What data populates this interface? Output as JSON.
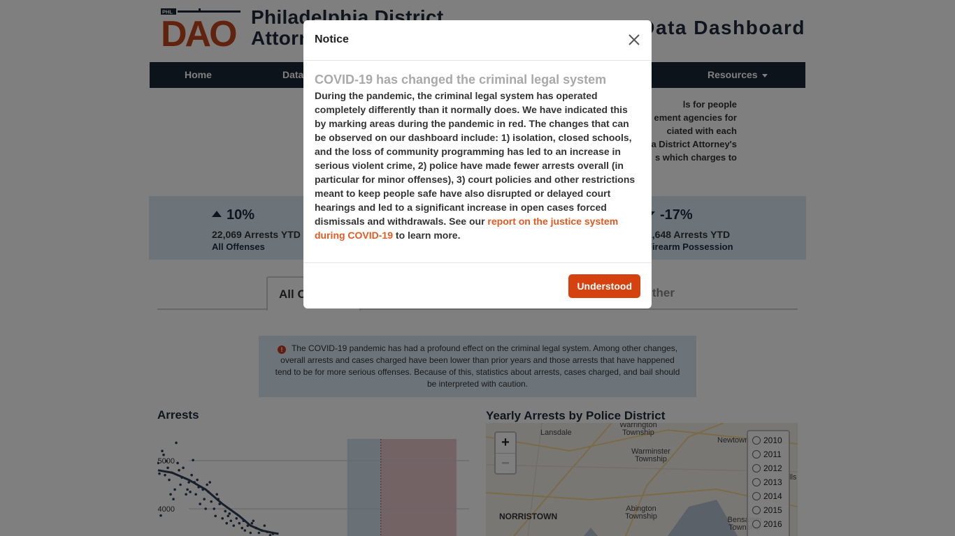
{
  "header": {
    "logo_badge": "PHL",
    "logo_text": "DAO",
    "site_title_line1": "Philadelphia District",
    "site_title_line2": "Attorney's Office",
    "dashboard_title": "Public Data Dashboard"
  },
  "nav": {
    "items": [
      "Home",
      "Data",
      "Resources"
    ]
  },
  "intro": {
    "lines": [
      "ls for people",
      "ement agencies for",
      "ciated with each",
      "a District Attorney's",
      "s which charges to"
    ]
  },
  "stats": [
    {
      "direction": "up",
      "percent": "10%",
      "count": "22,069 Arrests YTD",
      "category": "All Offenses"
    },
    {
      "direction": "down",
      "percent": "-17%",
      "count": "1,648 Arrests YTD",
      "category": "Firearm Possession"
    }
  ],
  "tabs": {
    "active": "All Offenses",
    "other": "Other"
  },
  "covid_note": {
    "icon": "exclamation-circle-icon",
    "text": "The COVID-19 pandemic has had a profound effect on the criminal legal system. Among other changes, overall arrests and cases charged have been lower than prior years and those arrests that have happened tend to be for more serious offenses. Because of this, statistics about arrests, cases charged, and bail should be interpreted with caution."
  },
  "arrests_chart": {
    "title": "Arrests"
  },
  "chart_data": {
    "type": "scatter",
    "title": "Arrests",
    "xlabel": "",
    "ylabel": "",
    "y_ticks": [
      4000,
      5000
    ],
    "ylim": [
      3450,
      5450
    ],
    "x_range": [
      0,
      1
    ],
    "points": [
      [
        0.01,
        4950
      ],
      [
        0.015,
        4730
      ],
      [
        0.02,
        3860
      ],
      [
        0.025,
        5200
      ],
      [
        0.03,
        5120
      ],
      [
        0.035,
        4700
      ],
      [
        0.04,
        4990
      ],
      [
        0.045,
        4850
      ],
      [
        0.05,
        4600
      ],
      [
        0.055,
        4300
      ],
      [
        0.06,
        4750
      ],
      [
        0.065,
        4200
      ],
      [
        0.07,
        4400
      ],
      [
        0.075,
        5370
      ],
      [
        0.08,
        4950
      ],
      [
        0.085,
        4800
      ],
      [
        0.09,
        4500
      ],
      [
        0.095,
        4650
      ],
      [
        0.1,
        4850
      ],
      [
        0.11,
        4300
      ],
      [
        0.115,
        4400
      ],
      [
        0.12,
        4550
      ],
      [
        0.125,
        4350
      ],
      [
        0.13,
        4700
      ],
      [
        0.135,
        5010
      ],
      [
        0.14,
        4550
      ],
      [
        0.145,
        4300
      ],
      [
        0.15,
        4600
      ],
      [
        0.155,
        4450
      ],
      [
        0.16,
        4100
      ],
      [
        0.17,
        4400
      ],
      [
        0.175,
        4200
      ],
      [
        0.18,
        4000
      ],
      [
        0.185,
        4500
      ],
      [
        0.19,
        4350
      ],
      [
        0.195,
        4550
      ],
      [
        0.2,
        4150
      ],
      [
        0.21,
        4000
      ],
      [
        0.215,
        3850
      ],
      [
        0.22,
        4300
      ],
      [
        0.225,
        4200
      ],
      [
        0.23,
        4100
      ],
      [
        0.24,
        3800
      ],
      [
        0.25,
        3950
      ],
      [
        0.255,
        3700
      ],
      [
        0.26,
        3850
      ],
      [
        0.265,
        3900
      ],
      [
        0.27,
        3750
      ],
      [
        0.28,
        3650
      ],
      [
        0.29,
        3800
      ],
      [
        0.3,
        3700
      ],
      [
        0.31,
        3600
      ],
      [
        0.315,
        3750
      ],
      [
        0.32,
        3550
      ],
      [
        0.33,
        3650
      ],
      [
        0.34,
        3500
      ],
      [
        0.345,
        3700
      ],
      [
        0.35,
        3750
      ],
      [
        0.36,
        3600
      ],
      [
        0.37,
        3500
      ],
      [
        0.38,
        3550
      ],
      [
        0.39,
        3650
      ],
      [
        0.4,
        3520
      ],
      [
        0.41,
        3450
      ],
      [
        0.42,
        3480
      ]
    ],
    "trend": [
      [
        0.01,
        4800
      ],
      [
        0.06,
        4750
      ],
      [
        0.12,
        4600
      ],
      [
        0.18,
        4400
      ],
      [
        0.24,
        4100
      ],
      [
        0.3,
        3850
      ],
      [
        0.34,
        3650
      ],
      [
        0.38,
        3550
      ],
      [
        0.42,
        3500
      ],
      [
        0.44,
        3480
      ]
    ],
    "shaded_regions": [
      {
        "x0": 0.565,
        "x1": 0.685,
        "color": "#d3e3ef"
      },
      {
        "x0": 0.685,
        "x1": 0.955,
        "color": "#e7c6ca"
      }
    ],
    "divider_x": 0.685,
    "marker_color": "#2c3e55",
    "grid": true
  },
  "map": {
    "title": "Yearly Arrests by Police District",
    "labels": [
      {
        "text": "Warrington Township",
        "cls": ""
      },
      {
        "text": "Lansdale",
        "cls": ""
      },
      {
        "text": "Newtown",
        "cls": ""
      },
      {
        "text": "Warminster Township",
        "cls": ""
      },
      {
        "text": "Abington Township",
        "cls": ""
      },
      {
        "text": "NORRISTOWN",
        "cls": "big"
      },
      {
        "text": "Bensalem Township",
        "cls": ""
      },
      {
        "text": "lls",
        "cls": ""
      }
    ],
    "zoom_in": "+",
    "zoom_out": "−",
    "years": [
      "2010",
      "2011",
      "2012",
      "2013",
      "2014",
      "2015",
      "2016"
    ]
  },
  "modal": {
    "title": "Notice",
    "close_icon": "close-icon",
    "heading": "COVID-19 has changed the criminal legal system",
    "body_text": "During the pandemic, the criminal legal system has operated completely differently than it normally does. We have indicated this by marking areas during the pandemic in red. The changes that can be observed on our dashboard include: 1) isolation, closed schools, and the loss of community programming has led to an increase in serious violent crime, 2) police have made fewer arrests overall (in particular for minor offenses), 3) court policies and other restrictions meant to keep people safe have also disrupted or delayed court hearings and led to a significant increase in open cases forced dismissals and withdrawals. See our",
    "link_text": "report on the justice system during COVID-19",
    "body_suffix": "to learn more.",
    "button_label": "Understood"
  },
  "colors": {
    "navy": "#1b2636",
    "brand_orange": "#d6420f",
    "brand_blue": "#3a5fa0",
    "band_blue": "#d9e9f5",
    "link_orange": "#e05a21"
  }
}
